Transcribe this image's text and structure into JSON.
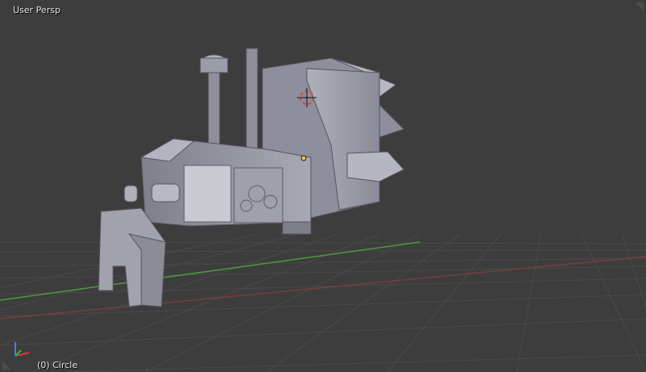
{
  "viewport": {
    "view_name": "User Persp",
    "object_info": "(0) Circle",
    "colors": {
      "background": "#3d3d3d",
      "grid": "#4b4b4b",
      "x_axis": "#8a3a3a",
      "y_axis": "#4d9a3d",
      "model": "#9a9aa6",
      "model_shadow": "#5e5e6a",
      "label_text": "#e6e6e6"
    }
  },
  "axis_gizmo": {
    "icon": "axis-gizmo-icon"
  },
  "cursor_3d": {
    "icon": "3d-cursor-icon"
  },
  "origin_point": {
    "icon": "object-origin-icon"
  },
  "corner_widgets": {
    "top_right_icon": "area-split-widget-icon",
    "bottom_left_icon": "area-split-widget-icon"
  }
}
